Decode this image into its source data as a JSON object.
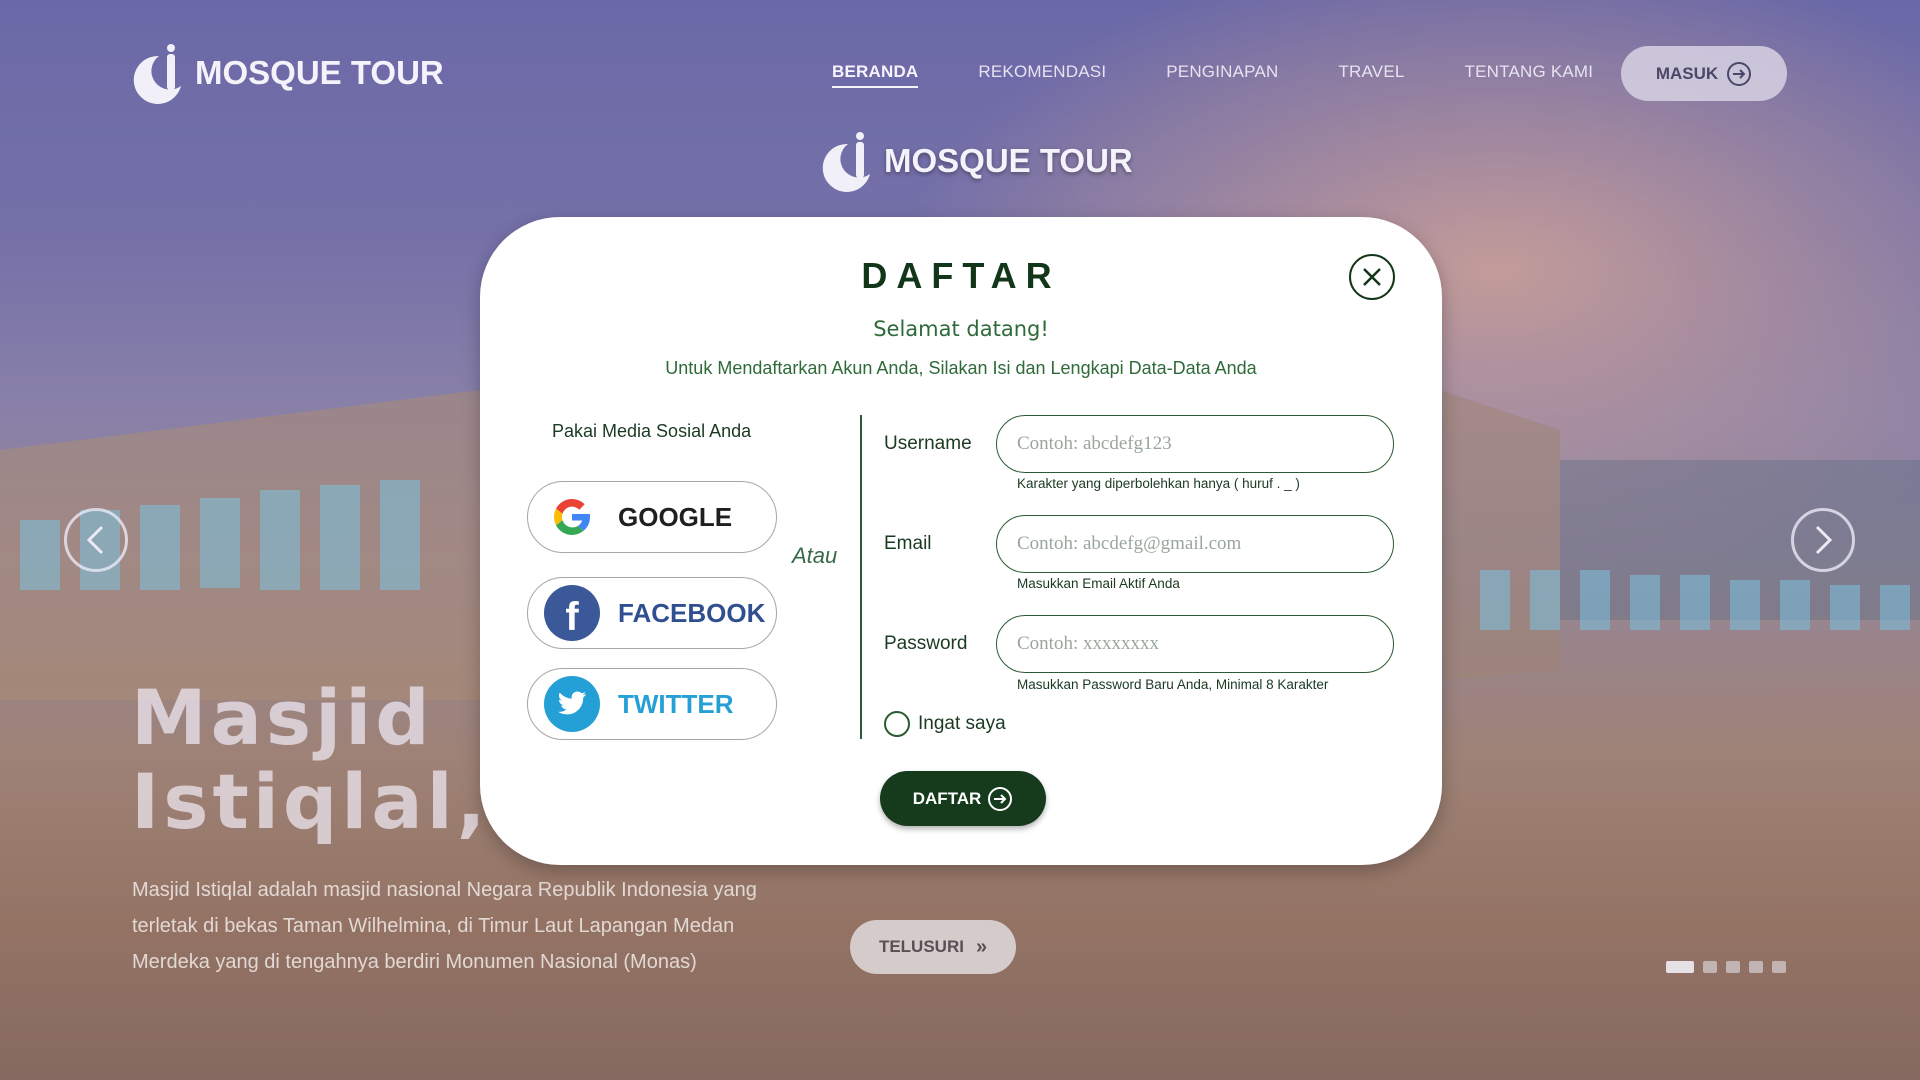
{
  "header": {
    "brand": "MOSQUE TOUR",
    "nav": [
      "BERANDA",
      "REKOMENDASI",
      "PENGINAPAN",
      "TRAVEL",
      "TENTANG KAMI"
    ],
    "login_label": "MASUK"
  },
  "hero": {
    "title_line1": "Masjid",
    "title_line2": "Istiqlal, J",
    "description": "Masjid Istiqlal adalah masjid nasional Negara Republik Indonesia yang terletak di bekas Taman Wilhelmina, di Timur Laut Lapangan Medan Merdeka yang di tengahnya berdiri Monumen Nasional (Monas)",
    "explore_label": "TELUSURI"
  },
  "modal": {
    "brand": "MOSQUE TOUR",
    "title": "DAFTAR",
    "welcome": "Selamat datang!",
    "subtitle": "Untuk Mendaftarkan Akun Anda, Silakan Isi dan Lengkapi Data-Data Anda",
    "social_label": "Pakai Media Sosial Anda",
    "social": {
      "google": "GOOGLE",
      "facebook": "FACEBOOK",
      "twitter": "TWITTER"
    },
    "or_label": "Atau",
    "fields": {
      "username": {
        "label": "Username",
        "placeholder": "Contoh: abcdefg123",
        "hint": "Karakter yang diperbolehkan hanya ( huruf . _ )"
      },
      "email": {
        "label": "Email",
        "placeholder": "Contoh: abcdefg@gmail.com",
        "hint": "Masukkan Email Aktif Anda"
      },
      "password": {
        "label": "Password",
        "placeholder": "Contoh: xxxxxxxx",
        "hint": "Masukkan Password Baru Anda, Minimal 8 Karakter"
      }
    },
    "remember_label": "Ingat saya",
    "submit_label": "DAFTAR"
  },
  "colors": {
    "primary": "#163a1c",
    "accent_text": "#2e6a3a",
    "google_blue": "#4285f4",
    "facebook": "#2f4f91",
    "twitter": "#25a0d6"
  }
}
